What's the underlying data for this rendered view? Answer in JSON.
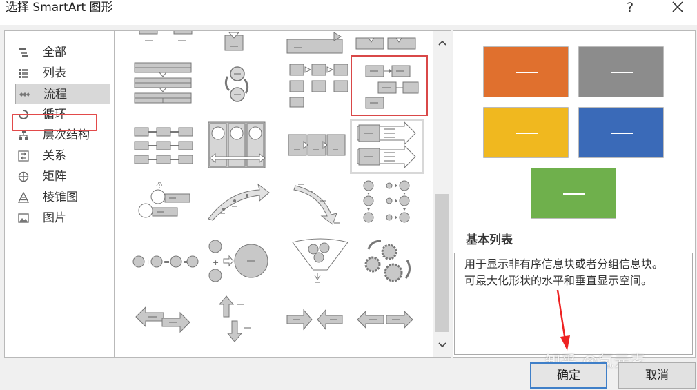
{
  "window": {
    "title": "选择 SmartArt 图形",
    "help_label": "?"
  },
  "categories": [
    {
      "label": "全部",
      "icon": "all-icon"
    },
    {
      "label": "列表",
      "icon": "list-icon"
    },
    {
      "label": "流程",
      "icon": "process-icon",
      "selected": true
    },
    {
      "label": "循环",
      "icon": "cycle-icon"
    },
    {
      "label": "层次结构",
      "icon": "hierarchy-icon"
    },
    {
      "label": "关系",
      "icon": "relationship-icon"
    },
    {
      "label": "矩阵",
      "icon": "matrix-icon"
    },
    {
      "label": "棱锥图",
      "icon": "pyramid-icon"
    },
    {
      "label": "图片",
      "icon": "picture-icon"
    }
  ],
  "preview": {
    "colors": [
      "#e0702e",
      "#8c8c8c",
      "#f0b81f",
      "#3a6ab8",
      "#6fb04c"
    ],
    "title": "基本列表",
    "description_lines": [
      "用于显示非有序信息块或者分组信息块。",
      "可最大化形状的水平和垂直显示空间。"
    ]
  },
  "buttons": {
    "ok": "确定",
    "cancel": "取消"
  },
  "watermark": "知乎 @氢元素",
  "accent": {
    "highlight_red": "#e24a4a",
    "focus_blue": "#3f7fc8"
  }
}
